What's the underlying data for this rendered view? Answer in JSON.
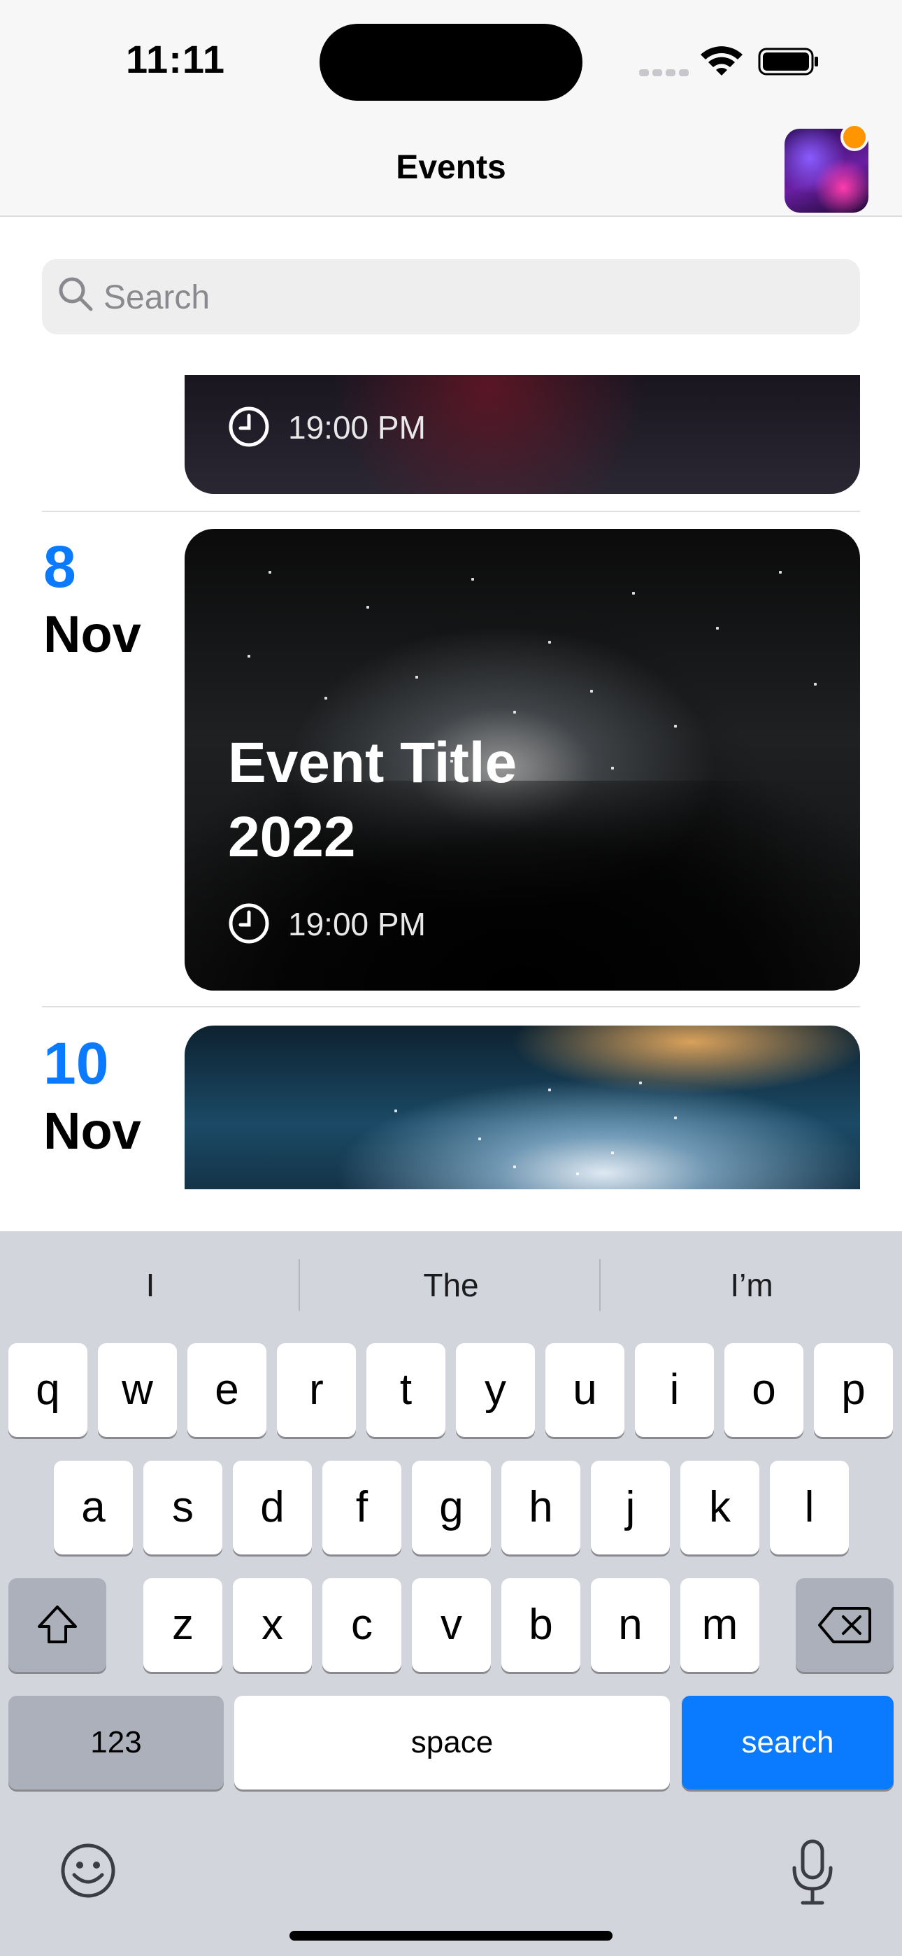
{
  "status_bar": {
    "time": "11:11"
  },
  "nav": {
    "title": "Events"
  },
  "search": {
    "placeholder": "Search"
  },
  "events": [
    {
      "time": "19:00 PM"
    },
    {
      "day": "8",
      "month": "Nov",
      "title_line1": "Event Title",
      "title_line2": "2022",
      "time": "19:00 PM"
    },
    {
      "day": "10",
      "month": "Nov"
    }
  ],
  "keyboard": {
    "suggestions": [
      "I",
      "The",
      "I’m"
    ],
    "row1": [
      "q",
      "w",
      "e",
      "r",
      "t",
      "y",
      "u",
      "i",
      "o",
      "p"
    ],
    "row2": [
      "a",
      "s",
      "d",
      "f",
      "g",
      "h",
      "j",
      "k",
      "l"
    ],
    "row3": [
      "z",
      "x",
      "c",
      "v",
      "b",
      "n",
      "m"
    ],
    "numbers_key": "123",
    "space_key": "space",
    "action_key": "search"
  },
  "colors": {
    "accent": "#0a7aff",
    "badge": "#ff9500"
  }
}
